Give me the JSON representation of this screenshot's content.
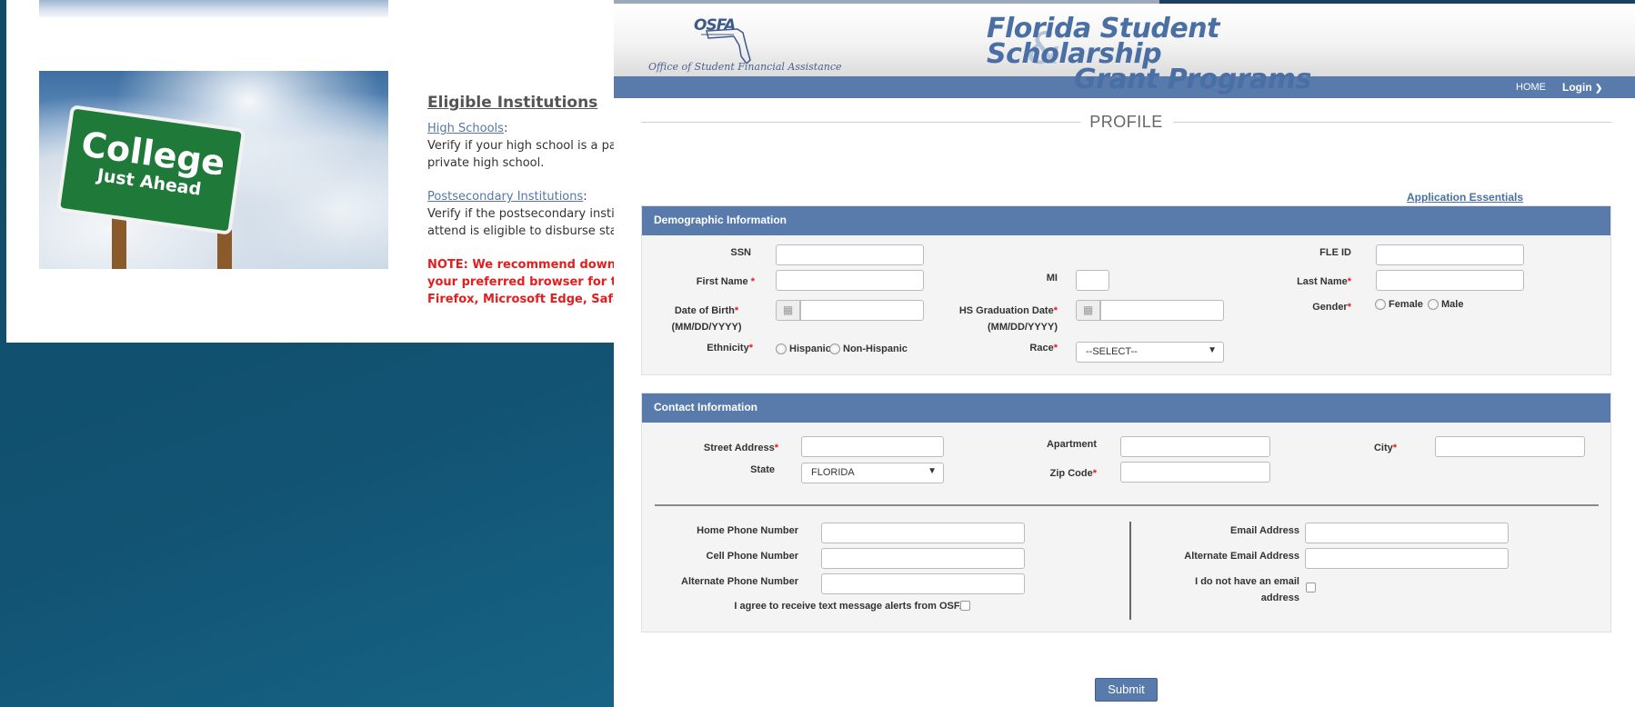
{
  "background_page": {
    "sign": {
      "line1": "College",
      "line2": "Just Ahead"
    },
    "eligible_heading": "Eligible Institutions",
    "high_schools_link": "High Schools",
    "high_schools_text_1": "Verify if your high school is a partici",
    "high_schools_text_2": "private high school.",
    "postsecondary_link": "Postsecondary Institutions",
    "postsecondary_text_1": "Verify if the postsecondary instituti",
    "postsecondary_text_2": "attend is eligible to disburse state a",
    "note_1": "NOTE: We recommend downloadi",
    "note_2": "your preferred browser for the bes",
    "note_3": "Firefox, Microsoft Edge, Safari)"
  },
  "header": {
    "logo_text": "OSFA",
    "office_label": "Office of Student Financial Assistance",
    "title_line1": "Florida Student Scholarship",
    "title_amp": "&",
    "title_line2": "Grant Programs"
  },
  "nav": {
    "home": "HOME",
    "login": "Login",
    "login_icon": "chevron-down-icon"
  },
  "page_title": "PROFILE",
  "application_essentials": "Application Essentials",
  "demographic": {
    "title": "Demographic Information",
    "ssn_label": "SSN",
    "fle_id_label": "FLE ID",
    "first_name_label": "First Name",
    "mi_label": "MI",
    "last_name_label": "Last Name",
    "dob_label": "Date of Birth",
    "dob_format": "(MM/DD/YYYY)",
    "hs_grad_label": "HS Graduation Date",
    "hs_grad_format": "(MM/DD/YYYY)",
    "gender_label": "Gender",
    "gender_options": [
      "Female",
      "Male"
    ],
    "ethnicity_label": "Ethnicity",
    "ethnicity_options": [
      "Hispanic",
      "Non-Hispanic"
    ],
    "race_label": "Race",
    "race_selected": "--SELECT--",
    "required_mark": "*"
  },
  "contact": {
    "title": "Contact Information",
    "street_label": "Street Address",
    "apartment_label": "Apartment",
    "city_label": "City",
    "state_label": "State",
    "state_selected": "FLORIDA",
    "zip_label": "Zip Code",
    "home_phone_label": "Home Phone Number",
    "cell_phone_label": "Cell Phone Number",
    "alt_phone_label": "Alternate Phone Number",
    "text_alerts_label": "I agree to receive text message alerts from OSFA.",
    "email_label": "Email Address",
    "alt_email_label": "Alternate Email Address",
    "no_email_label_1": "I do not have an email",
    "no_email_label_2": "address"
  },
  "submit_label": "Submit",
  "colors": {
    "accent": "#587bac",
    "required": "#e21e1e",
    "title": "#4a6fa5",
    "note": "#e21e1e"
  }
}
